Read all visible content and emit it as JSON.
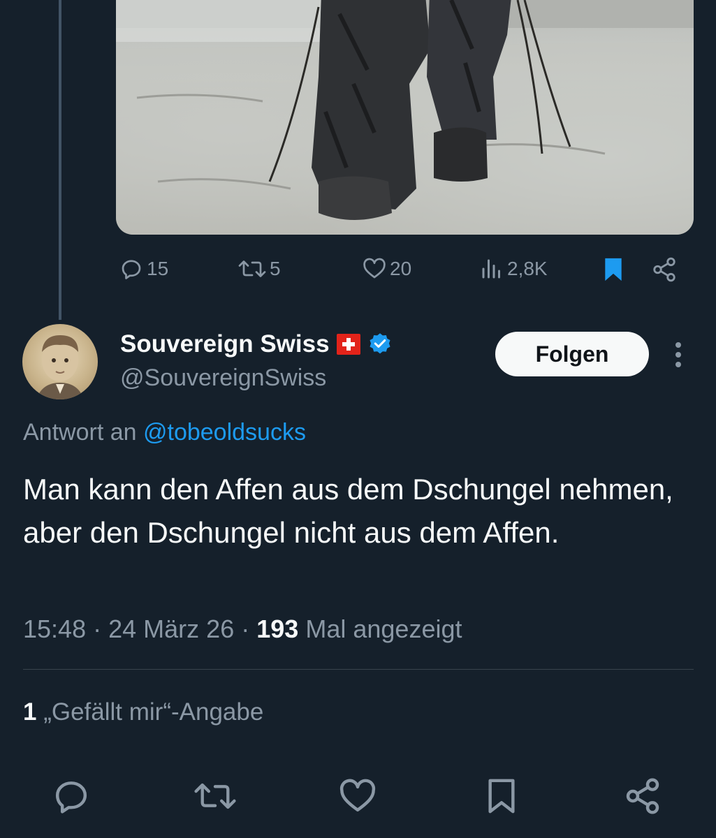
{
  "top_tweet": {
    "actions": {
      "replies": "15",
      "reposts": "5",
      "likes": "20",
      "views": "2,8K"
    },
    "bookmark_color": "#1d9bf0"
  },
  "reply": {
    "display_name": "Souvereign Swiss",
    "handle": "@SouvereignSwiss",
    "follow_label": "Folgen",
    "reply_to_prefix": "Antwort an",
    "reply_to_handle": "@tobeoldsucks",
    "text": "Man kann den Affen aus dem Dschungel nehmen, aber den Dschungel nicht aus dem Affen.",
    "time": "15:48",
    "date": "24 März 26",
    "view_count": "193",
    "views_label": "Mal angezeigt",
    "like_count": "1",
    "likes_label": "„Gefällt mir“-Angabe"
  },
  "colors": {
    "background": "#15202b",
    "text": "#f7f9f9",
    "muted": "#8b98a5",
    "accent": "#1d9bf0",
    "verified": "#1d9bf0",
    "swiss_flag": "#e2231a"
  },
  "icons": [
    "reply-icon",
    "repost-icon",
    "like-icon",
    "views-icon",
    "bookmark-icon",
    "share-icon",
    "verified-badge-icon",
    "swiss-flag-icon",
    "more-icon"
  ]
}
